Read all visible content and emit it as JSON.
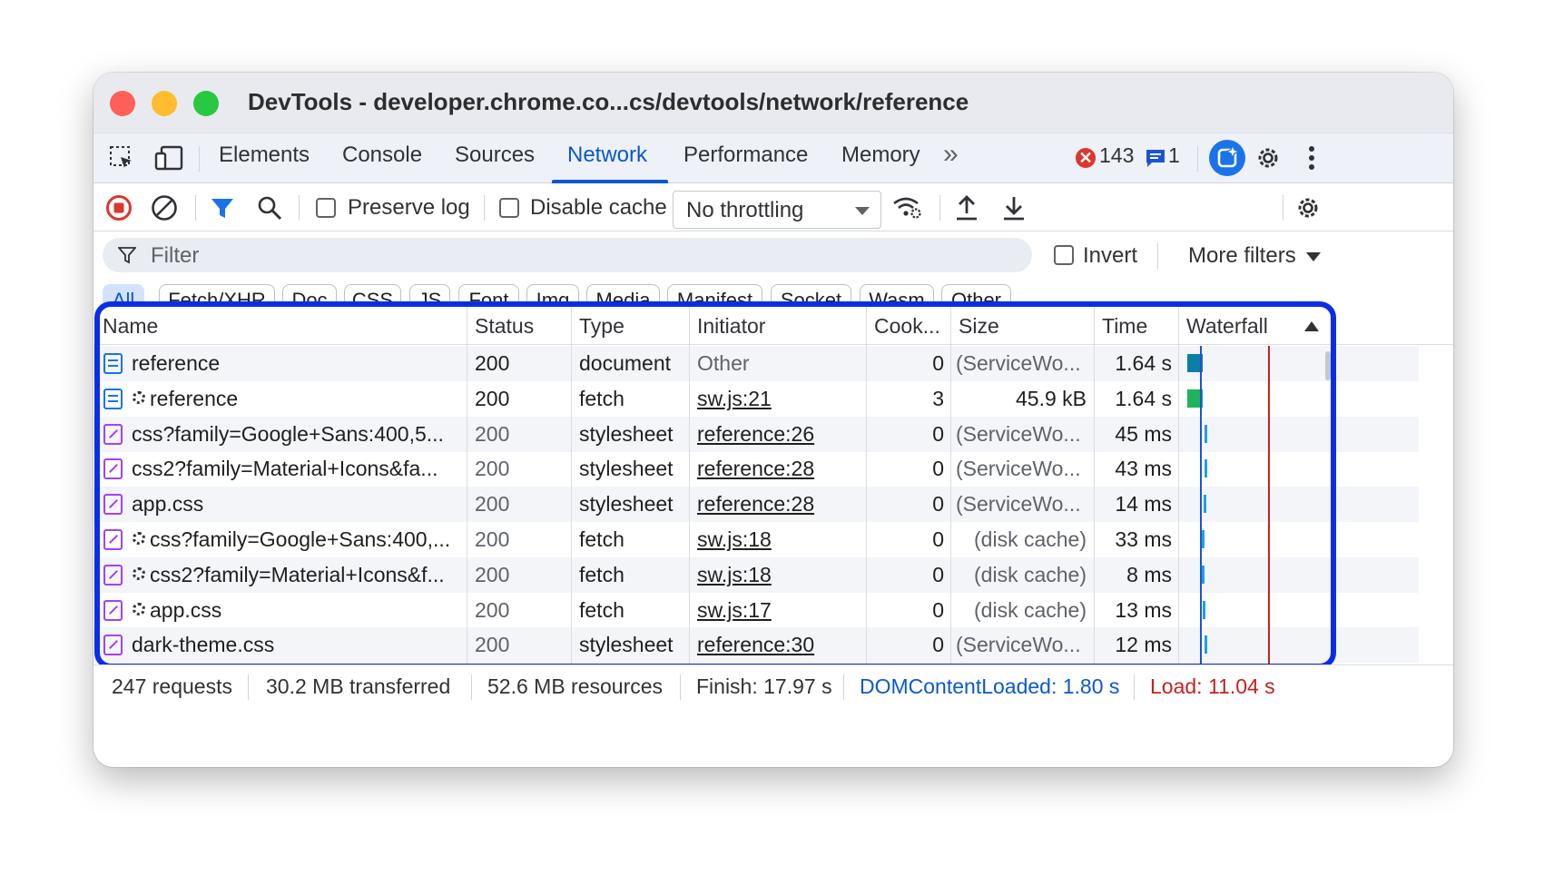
{
  "window": {
    "title": "DevTools - developer.chrome.co...cs/devtools/network/reference"
  },
  "tabs": [
    "Elements",
    "Console",
    "Sources",
    "Network",
    "Performance",
    "Memory"
  ],
  "active_tab": "Network",
  "more_tabs_glyph": "»",
  "errors": {
    "count": "143",
    "messages": "1"
  },
  "toolbar": {
    "preserve_log": "Preserve log",
    "disable_cache": "Disable cache",
    "throttling": "No throttling"
  },
  "filter": {
    "placeholder": "Filter",
    "invert": "Invert",
    "more_filters": "More filters"
  },
  "chips": [
    "All",
    "Fetch/XHR",
    "Doc",
    "CSS",
    "JS",
    "Font",
    "Img",
    "Media",
    "Manifest",
    "Socket",
    "Wasm",
    "Other"
  ],
  "columns": [
    "Name",
    "Status",
    "Type",
    "Initiator",
    "Cook...",
    "Size",
    "Time",
    "Waterfall"
  ],
  "rows": [
    {
      "name": "reference",
      "status": "200",
      "type": "document",
      "initiator": "Other",
      "cookies": "0",
      "size": "(ServiceWo...",
      "time": "1.64 s",
      "icon": "doc-icon",
      "gear": false
    },
    {
      "name": "reference",
      "status": "200",
      "type": "fetch",
      "initiator": "sw.js:21",
      "cookies": "3",
      "size": "45.9 kB",
      "time": "1.64 s",
      "icon": "doc-icon",
      "gear": true
    },
    {
      "name": "css?family=Google+Sans:400,5...",
      "status": "200",
      "type": "stylesheet",
      "initiator": "reference:26",
      "cookies": "0",
      "size": "(ServiceWo...",
      "time": "45 ms",
      "icon": "css-icon",
      "gear": false
    },
    {
      "name": "css2?family=Material+Icons&fa...",
      "status": "200",
      "type": "stylesheet",
      "initiator": "reference:28",
      "cookies": "0",
      "size": "(ServiceWo...",
      "time": "43 ms",
      "icon": "css-icon",
      "gear": false
    },
    {
      "name": "app.css",
      "status": "200",
      "type": "stylesheet",
      "initiator": "reference:28",
      "cookies": "0",
      "size": "(ServiceWo...",
      "time": "14 ms",
      "icon": "css-icon",
      "gear": false
    },
    {
      "name": "css?family=Google+Sans:400,...",
      "status": "200",
      "type": "fetch",
      "initiator": "sw.js:18",
      "cookies": "0",
      "size": "(disk cache)",
      "time": "33 ms",
      "icon": "css-icon",
      "gear": true
    },
    {
      "name": "css2?family=Material+Icons&f...",
      "status": "200",
      "type": "fetch",
      "initiator": "sw.js:18",
      "cookies": "0",
      "size": "(disk cache)",
      "time": "8 ms",
      "icon": "css-icon",
      "gear": true
    },
    {
      "name": "app.css",
      "status": "200",
      "type": "fetch",
      "initiator": "sw.js:17",
      "cookies": "0",
      "size": "(disk cache)",
      "time": "13 ms",
      "icon": "css-icon",
      "gear": true
    },
    {
      "name": "dark-theme.css",
      "status": "200",
      "type": "stylesheet",
      "initiator": "reference:30",
      "cookies": "0",
      "size": "(ServiceWo...",
      "time": "12 ms",
      "icon": "css-icon",
      "gear": false
    }
  ],
  "status_bar": {
    "requests": "247 requests",
    "transferred": "30.2 MB transferred",
    "resources": "52.6 MB resources",
    "finish": "Finish: 17.97 s",
    "dom_content_loaded": "DOMContentLoaded: 1.80 s",
    "load": "Load: 11.04 s"
  },
  "colors": {
    "accent": "#0b57d0",
    "highlight_border": "#0a2ee6",
    "error": "#dc362e",
    "dcl_line": "#1a54d4",
    "load_line": "#c5221f",
    "waterfall_doc": "#0b7fa8",
    "waterfall_fetch": "#1fb35a",
    "waterfall_css": "#1da1e8"
  }
}
